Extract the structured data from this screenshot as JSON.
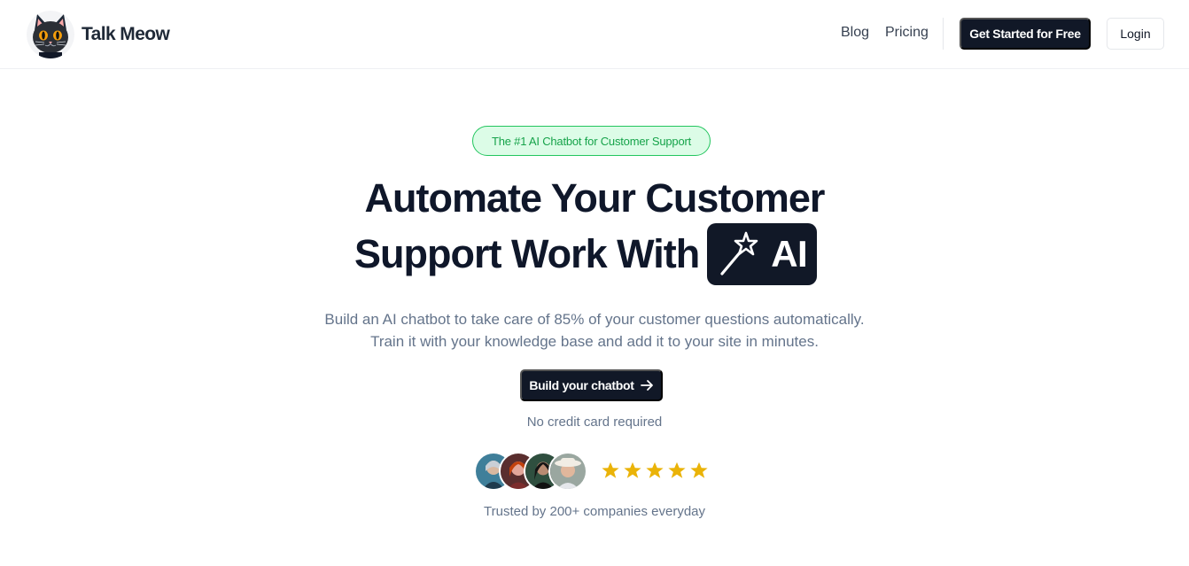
{
  "brand": {
    "name": "Talk Meow"
  },
  "nav": {
    "blog": "Blog",
    "pricing": "Pricing",
    "get_started": "Get Started for Free",
    "login": "Login"
  },
  "hero": {
    "badge": "The #1 AI Chatbot for Customer Support",
    "headline_line1": "Automate Your Customer",
    "headline_line2": "Support Work With",
    "ai_label": "AI",
    "subtitle_line1": "Build an AI chatbot to take care of 85% of your customer questions automatically.",
    "subtitle_line2": "Train it with your knowledge base and add it to your site in minutes.",
    "cta": "Build your chatbot",
    "no_credit_card": "No credit card required",
    "rating": 5,
    "trusted": "Trusted by 200+ companies everyday"
  },
  "colors": {
    "dark": "#111827",
    "badge_green": "#16a34a",
    "badge_bg": "#dcfce7",
    "star": "#eab308",
    "muted": "#64748b"
  },
  "icons": [
    "cat-logo-icon",
    "magic-wand-icon",
    "arrow-right-icon",
    "star-icon"
  ]
}
